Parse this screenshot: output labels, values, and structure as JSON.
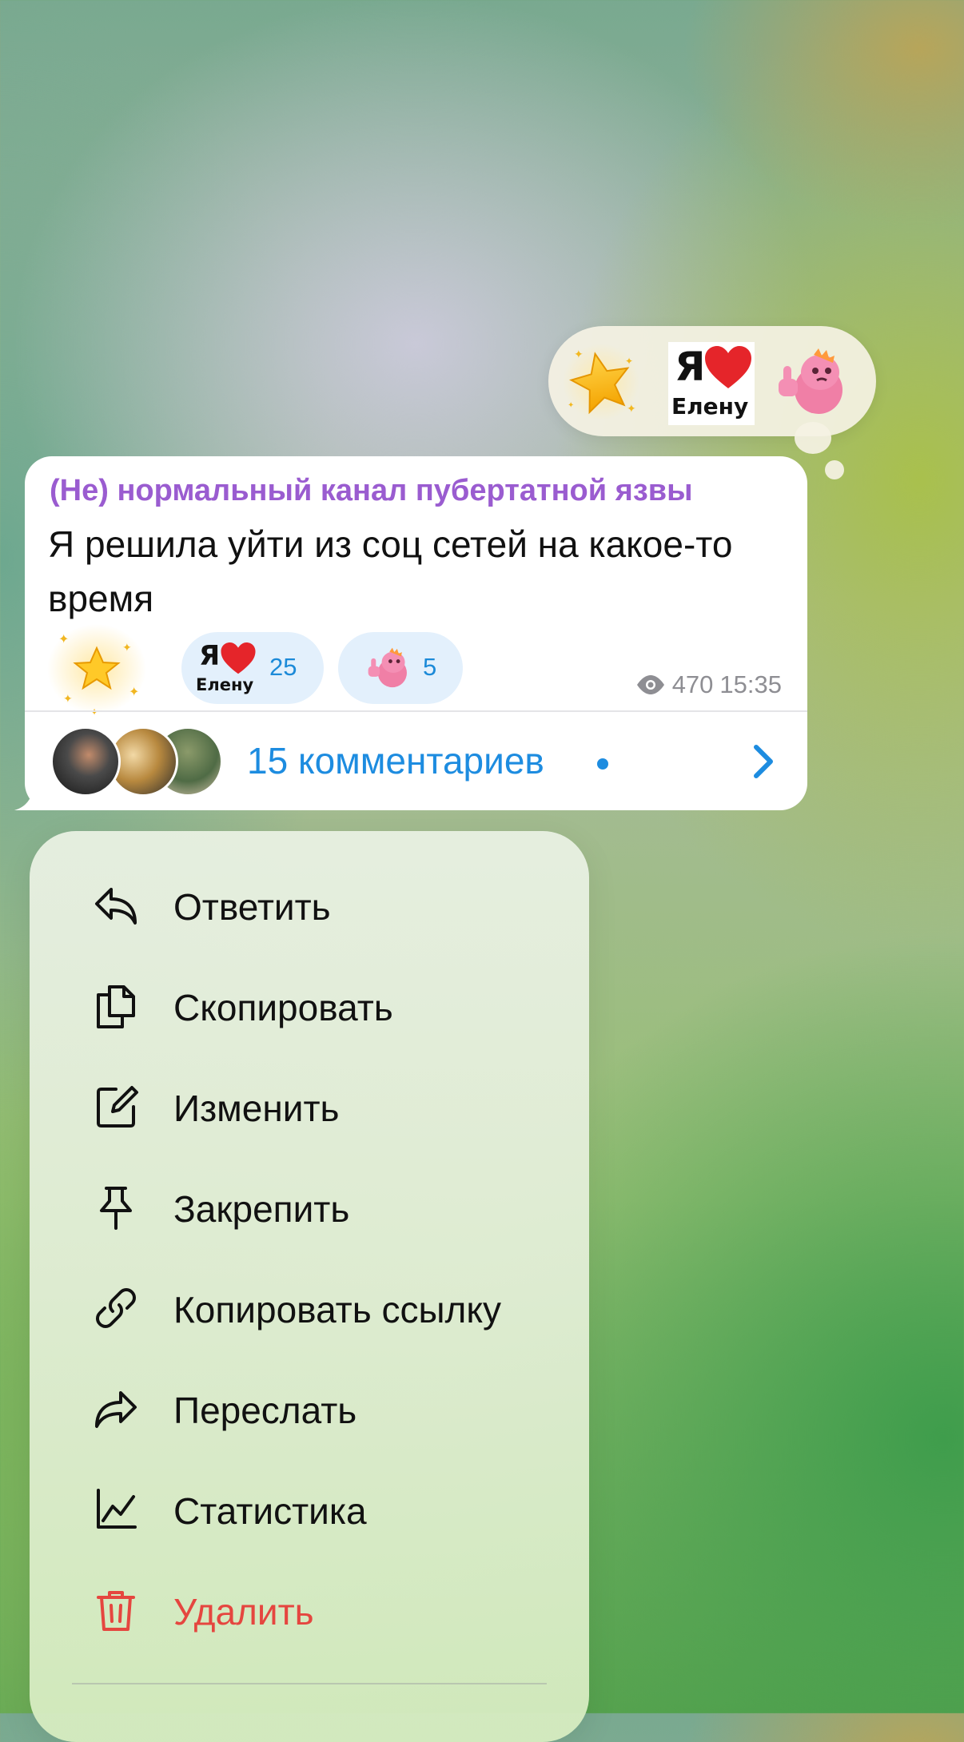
{
  "picker": {
    "reactions": [
      {
        "name": "sparkling-star-sticker"
      },
      {
        "name": "ya-heart-elenu-sticker",
        "text": "Я",
        "subtext": "Елену"
      },
      {
        "name": "pink-dino-thumbs-up-sticker"
      }
    ]
  },
  "message": {
    "channel_name": "(Не) нормальный канал пубертатной язвы",
    "text": "Я решила уйти из соц сетей на какое-то время",
    "reactions": [
      {
        "name": "star-reaction",
        "count": ""
      },
      {
        "name": "ya-heart-elenu-reaction",
        "text": "Я",
        "subtext": "Елену",
        "count": "25"
      },
      {
        "name": "pink-dino-reaction",
        "count": "5"
      }
    ],
    "views": "470",
    "time": "15:35",
    "comments_label": "15 комментариев",
    "accent_color": "#1d8ce0",
    "channel_color": "#9a5cd0"
  },
  "menu": {
    "items": [
      {
        "key": "reply",
        "label": "Ответить",
        "icon": "reply-icon"
      },
      {
        "key": "copy",
        "label": "Скопировать",
        "icon": "copy-icon"
      },
      {
        "key": "edit",
        "label": "Изменить",
        "icon": "edit-icon"
      },
      {
        "key": "pin",
        "label": "Закрепить",
        "icon": "pin-icon"
      },
      {
        "key": "copy-link",
        "label": "Копировать ссылку",
        "icon": "link-icon"
      },
      {
        "key": "forward",
        "label": "Переслать",
        "icon": "forward-icon"
      },
      {
        "key": "stats",
        "label": "Статистика",
        "icon": "stats-icon"
      },
      {
        "key": "delete",
        "label": "Удалить",
        "icon": "trash-icon",
        "danger_color": "#e5463f"
      }
    ]
  }
}
